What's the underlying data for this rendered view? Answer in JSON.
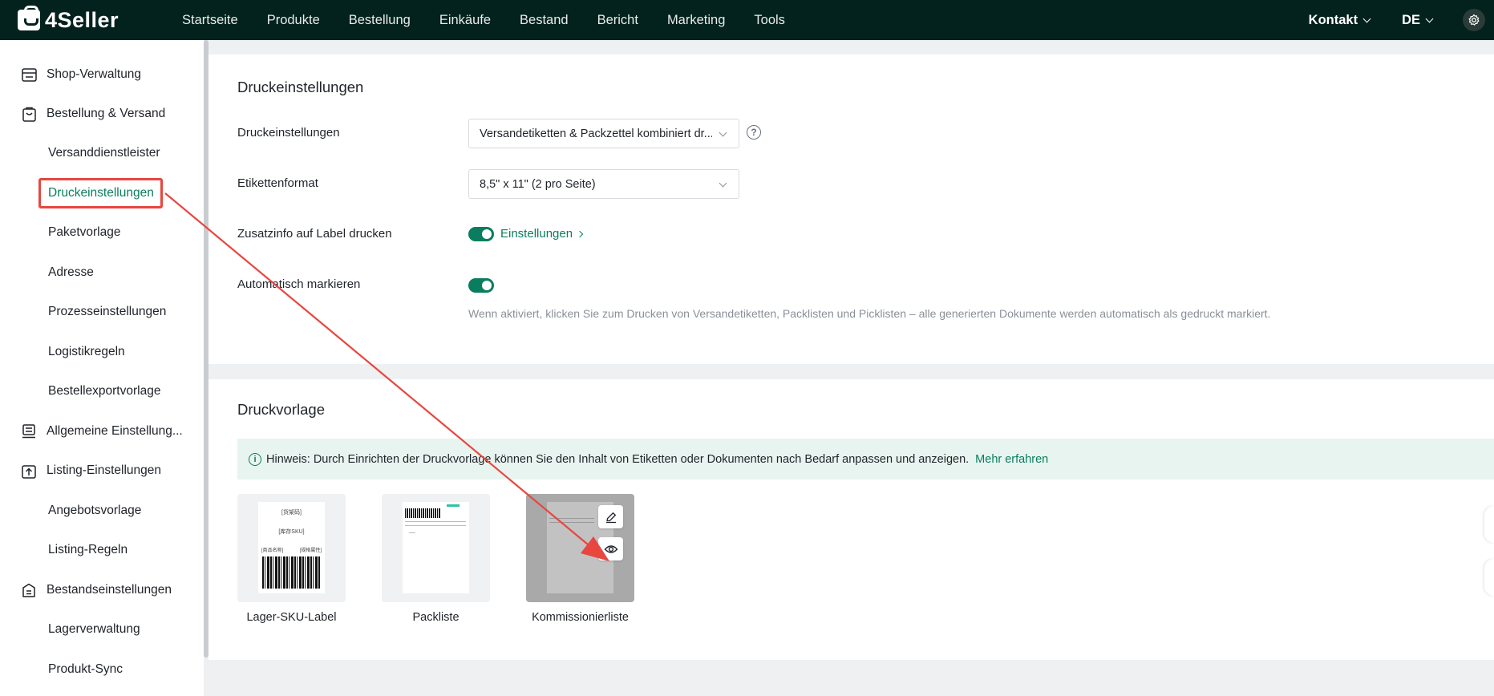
{
  "brand": {
    "name": "4Seller"
  },
  "topnav": {
    "items": [
      "Startseite",
      "Produkte",
      "Bestellung",
      "Einkäufe",
      "Bestand",
      "Bericht",
      "Marketing",
      "Tools"
    ],
    "contact": "Kontakt",
    "language": "DE"
  },
  "sidebar": {
    "items": [
      {
        "label": "Shop-Verwaltung",
        "icon": "shop-icon"
      },
      {
        "label": "Bestellung & Versand",
        "icon": "order-bag-icon"
      },
      {
        "label": "Versanddienstleister"
      },
      {
        "label": "Druckeinstellungen",
        "active": true
      },
      {
        "label": "Paketvorlage"
      },
      {
        "label": "Adresse"
      },
      {
        "label": "Prozesseinstellungen"
      },
      {
        "label": "Logistikregeln"
      },
      {
        "label": "Bestellexportvorlage"
      },
      {
        "label": "Allgemeine Einstellung...",
        "icon": "general-settings-icon"
      },
      {
        "label": "Listing-Einstellungen",
        "icon": "listing-upload-icon"
      },
      {
        "label": "Angebotsvorlage"
      },
      {
        "label": "Listing-Regeln"
      },
      {
        "label": "Bestandseinstellungen",
        "icon": "inventory-icon"
      },
      {
        "label": "Lagerverwaltung"
      },
      {
        "label": "Produkt-Sync"
      }
    ]
  },
  "print_settings": {
    "title": "Druckeinstellungen",
    "rows": {
      "print_label": "Druckeinstellungen",
      "print_value": "Versandetiketten & Packzettel kombiniert dr...",
      "format_label": "Etikettenformat",
      "format_value": "8,5\" x 11\" (2 pro Seite)",
      "extra_label": "Zusatzinfo auf Label drucken",
      "extra_link": "Einstellungen",
      "extra_enabled": true,
      "auto_label": "Automatisch markieren",
      "auto_enabled": true,
      "auto_desc": "Wenn aktiviert, klicken Sie zum Drucken von Versandetiketten, Packlisten und Picklisten – alle generierten Dokumente werden automatisch als gedruckt markiert."
    }
  },
  "templates": {
    "title": "Druckvorlage",
    "notice": "Hinweis: Durch Einrichten der Druckvorlage können Sie den Inhalt von Etiketten oder Dokumenten nach Bedarf anpassen und anzeigen.",
    "notice_link": "Mehr erfahren",
    "cards": [
      {
        "label": "Lager-SKU-Label",
        "thumb_texts": [
          "[货架码]",
          "[库存SKU]",
          "[商品名称]",
          "[规格属性]"
        ]
      },
      {
        "label": "Packliste"
      },
      {
        "label": "Kommissionierliste"
      }
    ]
  },
  "colors": {
    "accent": "#0a7d5e",
    "topbar": "#03211d",
    "annotation": "#e8463f"
  }
}
